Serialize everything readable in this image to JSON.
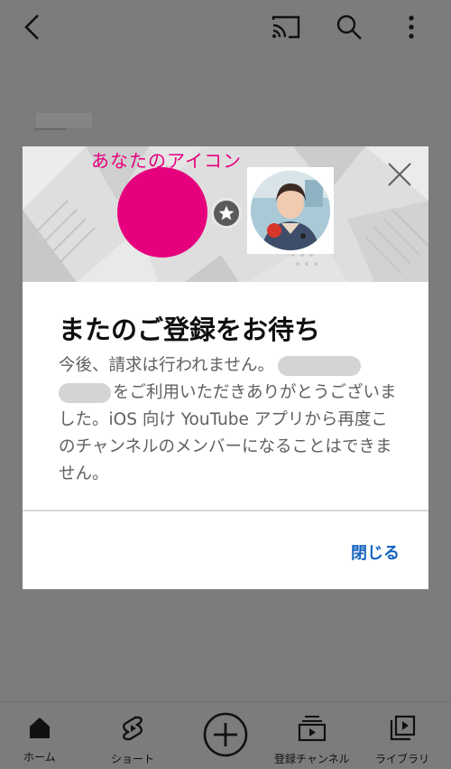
{
  "top_bar": {
    "icons": [
      "back-icon",
      "cast-icon",
      "search-icon",
      "more-vert-icon"
    ]
  },
  "dialog": {
    "annotation": "あなたのアイコン",
    "title": "またのご登録をお待ち",
    "body_line1": "今後、請求は行われません。",
    "body_line2": "をご利用いただきありがとうご",
    "body_rest": "ざいました。iOS 向け YouTube アプリから再度このチャンネルのメンバーになることはできません。",
    "close_label": "閉じる",
    "colors": {
      "accent": "#e6007e",
      "link": "#1565c0"
    }
  },
  "bottom_nav": {
    "items": [
      {
        "label": "ホーム",
        "icon": "home-icon"
      },
      {
        "label": "ショート",
        "icon": "shorts-icon"
      },
      {
        "label": "",
        "icon": "add-circle-icon"
      },
      {
        "label": "登録チャンネル",
        "icon": "subscriptions-icon"
      },
      {
        "label": "ライブラリ",
        "icon": "library-icon"
      }
    ]
  }
}
